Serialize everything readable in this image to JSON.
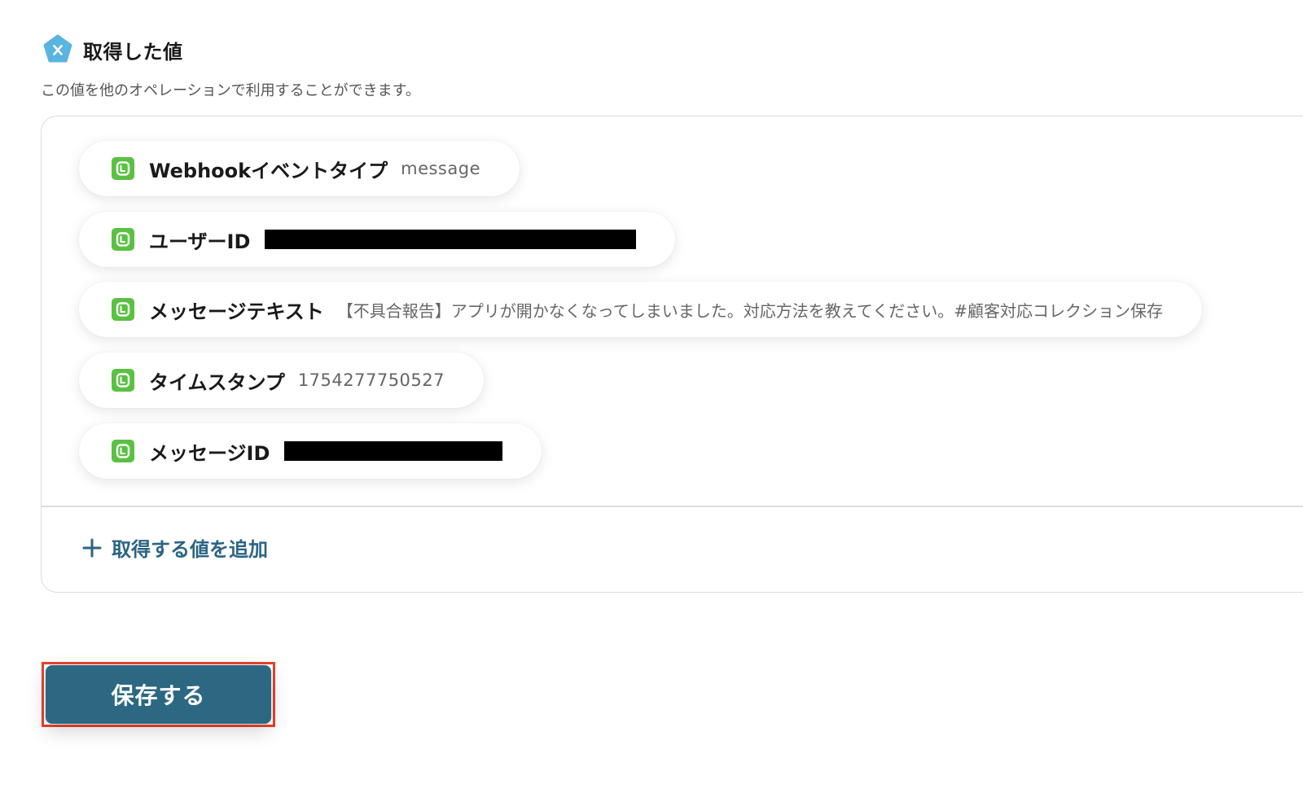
{
  "section": {
    "icon": "variable-x-icon",
    "title": "取得した値",
    "description": "この値を他のオペレーションで利用することができます。"
  },
  "values": [
    {
      "icon": "line-app-icon",
      "label": "Webhookイベントタイプ",
      "value": "message",
      "redacted": false
    },
    {
      "icon": "line-app-icon",
      "label": "ユーザーID",
      "value": "",
      "redacted": true
    },
    {
      "icon": "line-app-icon",
      "label": "メッセージテキスト",
      "value": "【不具合報告】アプリが開かなくなってしまいました。対応方法を教えてください。#顧客対応コレクション保存",
      "redacted": false
    },
    {
      "icon": "line-app-icon",
      "label": "タイムスタンプ",
      "value": "1754277750527",
      "redacted": false
    },
    {
      "icon": "line-app-icon",
      "label": "メッセージID",
      "value": "",
      "redacted": true
    }
  ],
  "add_value": {
    "icon": "plus-icon",
    "label": "取得する値を追加"
  },
  "save_button": {
    "label": "保存する"
  },
  "colors": {
    "accent": "#2d6883",
    "link": "#2a6585",
    "line_green": "#5ac142",
    "variable_blue": "#5ab4e0",
    "highlight_red": "#e8442a"
  }
}
